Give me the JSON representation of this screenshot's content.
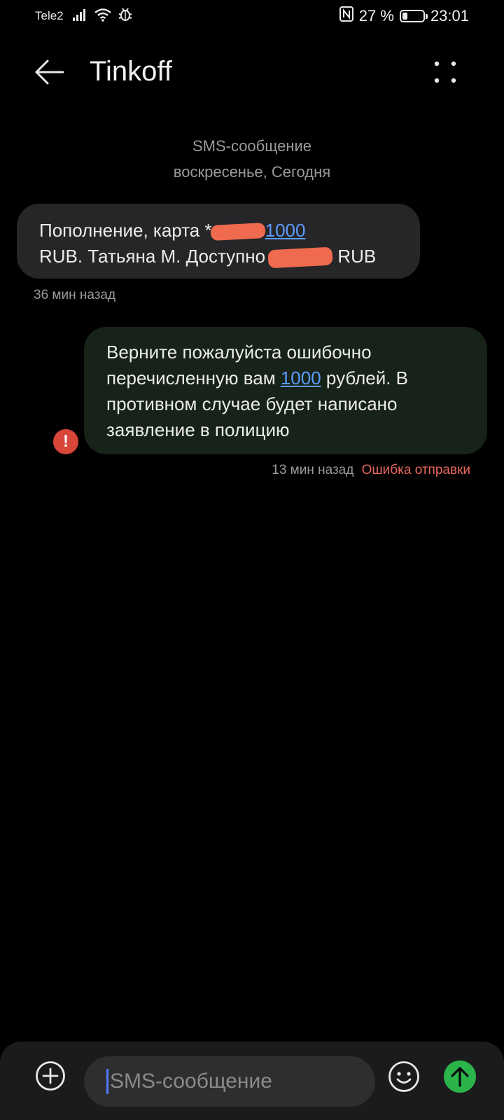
{
  "status_bar": {
    "carrier": "Tele2",
    "battery_percent": "27 %",
    "battery_level": 0.27,
    "time": "23:01",
    "icons": [
      "signal-icon",
      "wifi-icon",
      "bug-icon",
      "nfc-icon",
      "battery-icon"
    ]
  },
  "header": {
    "title": "Tinkoff",
    "back_icon": "arrow-left-icon",
    "more_icon": "more-dots-icon"
  },
  "thread": {
    "type_label": "SMS-сообщение",
    "date_label": "воскресенье, Сегодня"
  },
  "messages": [
    {
      "direction": "incoming",
      "line1_prefix": "Пополнение, карта *",
      "line1_amount": "1000",
      "line2_prefix": "RUB. Татьяна М. Доступно",
      "line2_suffix": " RUB",
      "time": "36 мин назад"
    },
    {
      "direction": "outgoing",
      "text_before": "Верните пожалуйста ошибочно перечисленную вам ",
      "amount": "1000",
      "text_after": " рублей.  В противном случае будет написано заявление в полицию",
      "time": "13 мин назад",
      "status": "Ошибка отправки"
    }
  ],
  "compose": {
    "placeholder": "SMS-сообщение",
    "attach_icon": "plus-circle-icon",
    "emoji_icon": "smiley-icon",
    "send_icon": "arrow-up-icon"
  },
  "colors": {
    "background": "#000000",
    "incoming_bubble": "#262628",
    "outgoing_bubble": "#172218",
    "link": "#5b9bff",
    "error": "#d8463a",
    "send": "#2ab44a",
    "redaction": "#f06a4f"
  }
}
